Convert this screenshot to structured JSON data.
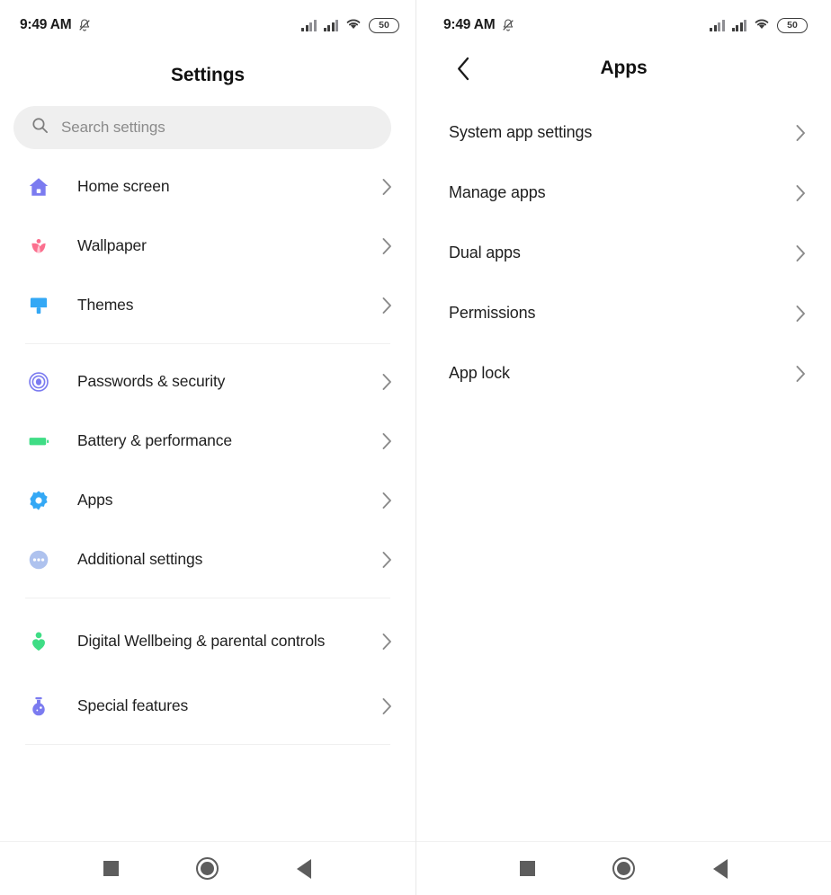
{
  "status_bar": {
    "time": "9:49 AM",
    "mute_icon": "bell-mute-icon",
    "signal_1_icon": "signal-bars-icon",
    "signal_2_icon": "signal-bars-icon",
    "wifi_icon": "wifi-icon",
    "battery_level": "50"
  },
  "left_screen": {
    "title": "Settings",
    "search": {
      "placeholder": "Search settings",
      "value": "",
      "icon": "search-icon"
    },
    "groups": [
      {
        "items": [
          {
            "label": "Home screen",
            "icon": "house-icon",
            "color": "#7b7bf0",
            "chevron": "chevron-right-icon"
          },
          {
            "label": "Wallpaper",
            "icon": "tulip-icon",
            "color": "#fb6f8e",
            "chevron": "chevron-right-icon"
          },
          {
            "label": "Themes",
            "icon": "paintbrush-icon",
            "color": "#34a8f5",
            "chevron": "chevron-right-icon"
          }
        ]
      },
      {
        "items": [
          {
            "label": "Passwords & security",
            "icon": "fingerprint-icon",
            "color": "#7b7bf0",
            "chevron": "chevron-right-icon"
          },
          {
            "label": "Battery & performance",
            "icon": "battery-icon",
            "color": "#3fdd85",
            "chevron": "chevron-right-icon"
          },
          {
            "label": "Apps",
            "icon": "gear-icon",
            "color": "#34a8f5",
            "chevron": "chevron-right-icon"
          },
          {
            "label": "Additional settings",
            "icon": "more-dots-icon",
            "color": "#aec2ee",
            "chevron": "chevron-right-icon"
          }
        ]
      },
      {
        "items": [
          {
            "label": "Digital Wellbeing & parental controls",
            "icon": "person-heart-icon",
            "color": "#3fdd85",
            "chevron": "chevron-right-icon"
          },
          {
            "label": "Special features",
            "icon": "flask-icon",
            "color": "#7b7bf0",
            "chevron": "chevron-right-icon"
          }
        ]
      }
    ]
  },
  "right_screen": {
    "title": "Apps",
    "back_icon": "chevron-left-icon",
    "items": [
      {
        "label": "System app settings",
        "chevron": "chevron-right-icon"
      },
      {
        "label": "Manage apps",
        "chevron": "chevron-right-icon"
      },
      {
        "label": "Dual apps",
        "chevron": "chevron-right-icon"
      },
      {
        "label": "Permissions",
        "chevron": "chevron-right-icon"
      },
      {
        "label": "App lock",
        "chevron": "chevron-right-icon"
      }
    ]
  },
  "nav_bar": {
    "recents_icon": "square-recents-icon",
    "home_icon": "circle-home-icon",
    "back_icon": "triangle-back-icon"
  }
}
